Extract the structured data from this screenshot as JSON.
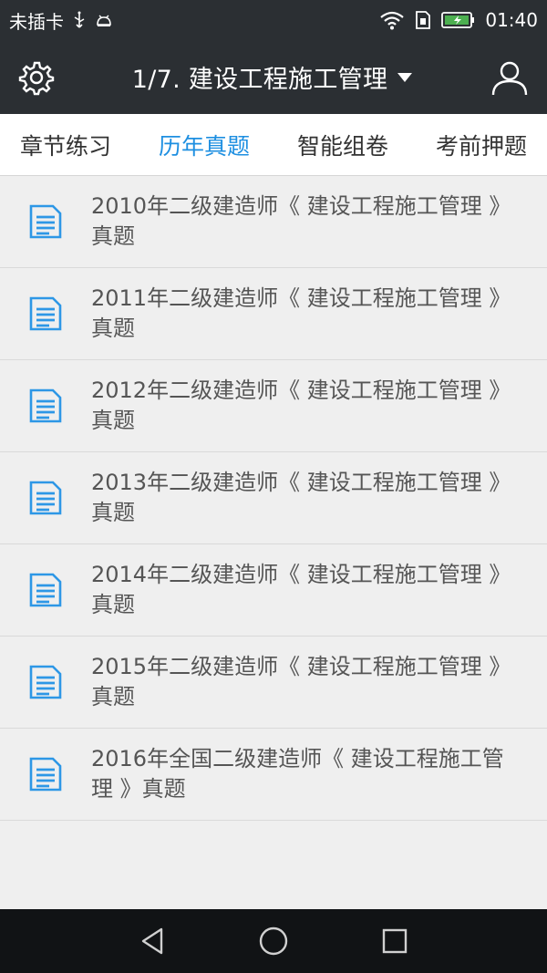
{
  "status_bar": {
    "carrier": "未插卡",
    "time": "01:40"
  },
  "header": {
    "title": "1/7. 建设工程施工管理"
  },
  "tabs": [
    {
      "label": "章节练习"
    },
    {
      "label": "历年真题"
    },
    {
      "label": "智能组卷"
    },
    {
      "label": "考前押题"
    }
  ],
  "list": {
    "items": [
      {
        "title": "2010年二级建造师《 建设工程施工管理 》真题"
      },
      {
        "title": "2011年二级建造师《 建设工程施工管理 》真题"
      },
      {
        "title": "2012年二级建造师《 建设工程施工管理 》真题"
      },
      {
        "title": "2013年二级建造师《 建设工程施工管理 》真题"
      },
      {
        "title": "2014年二级建造师《 建设工程施工管理 》真题"
      },
      {
        "title": "2015年二级建造师《 建设工程施工管理 》真题"
      },
      {
        "title": "2016年全国二级建造师《 建设工程施工管理 》真题"
      }
    ]
  },
  "colors": {
    "accent": "#1e8fe1",
    "toolbar": "#2b2f33",
    "background": "#efefef"
  }
}
